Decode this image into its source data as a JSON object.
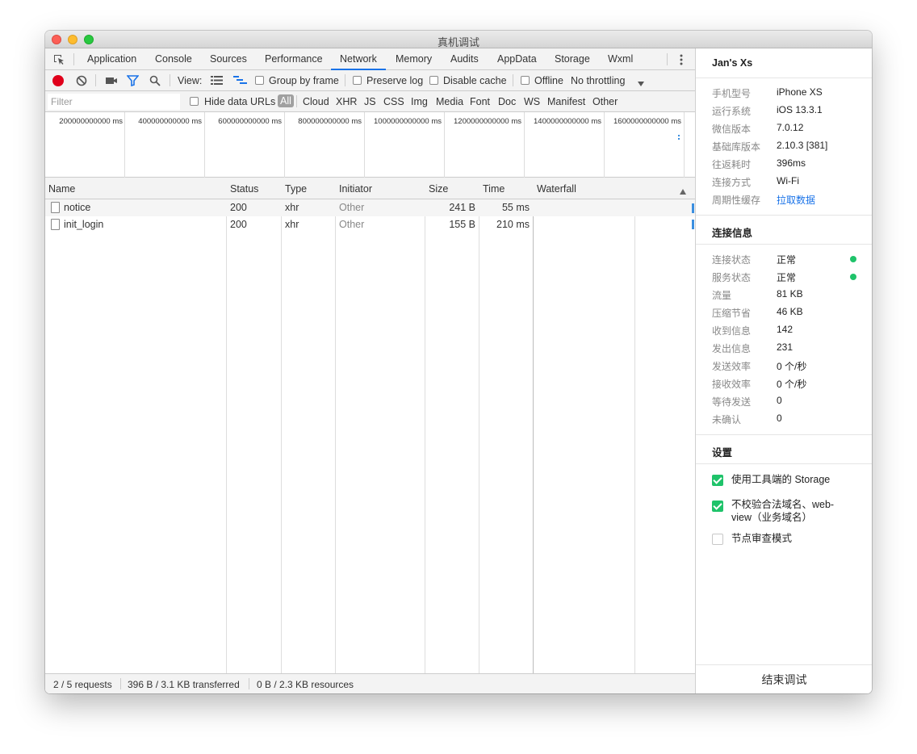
{
  "window": {
    "title": "真机调试"
  },
  "tabs": [
    {
      "label": "Application"
    },
    {
      "label": "Console"
    },
    {
      "label": "Sources"
    },
    {
      "label": "Performance"
    },
    {
      "label": "Network"
    },
    {
      "label": "Memory"
    },
    {
      "label": "Audits"
    },
    {
      "label": "AppData"
    },
    {
      "label": "Storage"
    },
    {
      "label": "Wxml"
    }
  ],
  "active_tab": "Network",
  "toolbar": {
    "view_label": "View:",
    "group_by_frame": "Group by frame",
    "preserve_log": "Preserve log",
    "disable_cache": "Disable cache",
    "offline": "Offline",
    "throttling": "No throttling"
  },
  "filterbar": {
    "placeholder": "Filter",
    "hide_data_urls": "Hide data URLs",
    "types": [
      "All",
      "Cloud",
      "XHR",
      "JS",
      "CSS",
      "Img",
      "Media",
      "Font",
      "Doc",
      "WS",
      "Manifest",
      "Other"
    ],
    "active_type": "All"
  },
  "overview": {
    "ticks": [
      "200000000000 ms",
      "400000000000 ms",
      "600000000000 ms",
      "800000000000 ms",
      "1000000000000 ms",
      "1200000000000 ms",
      "1400000000000 ms",
      "1600000000000 ms"
    ]
  },
  "table": {
    "columns": [
      "Name",
      "Status",
      "Type",
      "Initiator",
      "Size",
      "Time",
      "Waterfall"
    ],
    "rows": [
      {
        "name": "notice",
        "status": "200",
        "type": "xhr",
        "initiator": "Other",
        "size": "241 B",
        "time": "55 ms"
      },
      {
        "name": "init_login",
        "status": "200",
        "type": "xhr",
        "initiator": "Other",
        "size": "155 B",
        "time": "210 ms"
      }
    ]
  },
  "statusbar": {
    "requests": "2 / 5 requests",
    "transferred": "396 B / 3.1 KB transferred",
    "resources": "0 B / 2.3 KB resources"
  },
  "panel": {
    "device_name": "Jan's Xs",
    "device_info": [
      {
        "label": "手机型号",
        "value": "iPhone XS"
      },
      {
        "label": "运行系统",
        "value": "iOS 13.3.1"
      },
      {
        "label": "微信版本",
        "value": "7.0.12"
      },
      {
        "label": "基础库版本",
        "value": "2.10.3 [381]"
      },
      {
        "label": "往返耗时",
        "value": "396ms"
      },
      {
        "label": "连接方式",
        "value": "Wi-Fi"
      },
      {
        "label": "周期性缓存",
        "value": "拉取数据"
      }
    ],
    "connection_title": "连接信息",
    "connection_info": [
      {
        "label": "连接状态",
        "value": "正常"
      },
      {
        "label": "服务状态",
        "value": "正常"
      },
      {
        "label": "流量",
        "value": "81 KB"
      },
      {
        "label": "压缩节省",
        "value": "46 KB"
      },
      {
        "label": "收到信息",
        "value": "142"
      },
      {
        "label": "发出信息",
        "value": "231"
      },
      {
        "label": "发送效率",
        "value": "0 个/秒"
      },
      {
        "label": "接收效率",
        "value": "0 个/秒"
      },
      {
        "label": "等待发送",
        "value": "0"
      },
      {
        "label": "未确认",
        "value": "0"
      }
    ],
    "status_color": "#1fc36a",
    "settings_title": "设置",
    "settings": [
      {
        "label": "使用工具端的 Storage",
        "checked": true
      },
      {
        "label_line1": "不校验合法域名、web-",
        "label_line2": "view（业务域名）",
        "checked": true
      },
      {
        "label": "节点审查模式",
        "checked": false
      }
    ],
    "end_button": "结束调试"
  },
  "accent_color": "#1a73e8"
}
